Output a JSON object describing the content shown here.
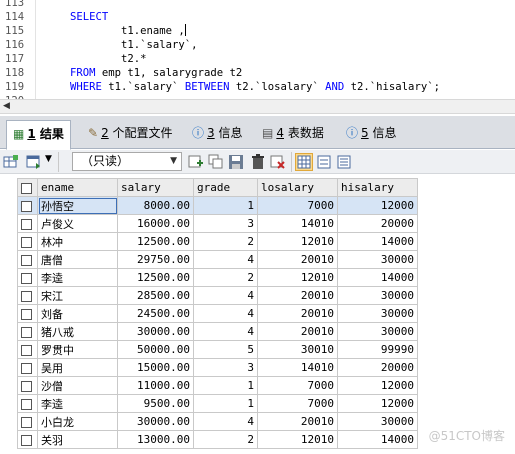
{
  "editor": {
    "lines": [
      {
        "num": "113",
        "tokens": []
      },
      {
        "num": "114",
        "tokens": [
          {
            "t": "SELECT",
            "kw": true
          }
        ]
      },
      {
        "num": "115",
        "tokens": [
          {
            "t": "        t1.ename ,",
            "kw": false
          }
        ]
      },
      {
        "num": "116",
        "tokens": [
          {
            "t": "        t1.`salary`,",
            "kw": false
          }
        ]
      },
      {
        "num": "117",
        "tokens": [
          {
            "t": "        t2.*",
            "kw": false
          }
        ]
      },
      {
        "num": "118",
        "tokens": [
          {
            "t": "FROM",
            "kw": true
          },
          {
            "t": " emp t1, salarygrade t2",
            "kw": false
          }
        ]
      },
      {
        "num": "119",
        "tokens": [
          {
            "t": "WHERE",
            "kw": true
          },
          {
            "t": " t1.`salary` ",
            "kw": false
          },
          {
            "t": "BETWEEN",
            "kw": true
          },
          {
            "t": " t2.`losalary` ",
            "kw": false
          },
          {
            "t": "AND",
            "kw": true
          },
          {
            "t": " t2.`hisalary`;",
            "kw": false
          }
        ]
      },
      {
        "num": "120",
        "tokens": []
      }
    ]
  },
  "tabs": [
    {
      "num": "1",
      "label": "结果",
      "icon": "result-grid-icon",
      "active": true
    },
    {
      "num": "2",
      "label": "个配置文件",
      "icon": "profile-icon",
      "active": false
    },
    {
      "num": "3",
      "label": "信息",
      "icon": "info-icon",
      "active": false
    },
    {
      "num": "4",
      "label": "表数据",
      "icon": "table-data-icon",
      "active": false
    },
    {
      "num": "5",
      "label": "信息",
      "icon": "info-icon",
      "active": false
    }
  ],
  "toolbar": {
    "readonly_value": "（只读）"
  },
  "grid": {
    "columns": [
      "ename",
      "salary",
      "grade",
      "losalary",
      "hisalary"
    ],
    "rows": [
      [
        "孙悟空",
        "8000.00",
        "1",
        "7000",
        "12000"
      ],
      [
        "卢俊义",
        "16000.00",
        "3",
        "14010",
        "20000"
      ],
      [
        "林冲",
        "12500.00",
        "2",
        "12010",
        "14000"
      ],
      [
        "唐僧",
        "29750.00",
        "4",
        "20010",
        "30000"
      ],
      [
        "李逵",
        "12500.00",
        "2",
        "12010",
        "14000"
      ],
      [
        "宋江",
        "28500.00",
        "4",
        "20010",
        "30000"
      ],
      [
        "刘备",
        "24500.00",
        "4",
        "20010",
        "30000"
      ],
      [
        "猪八戒",
        "30000.00",
        "4",
        "20010",
        "30000"
      ],
      [
        "罗贯中",
        "50000.00",
        "5",
        "30010",
        "99990"
      ],
      [
        "吴用",
        "15000.00",
        "3",
        "14010",
        "20000"
      ],
      [
        "沙僧",
        "11000.00",
        "1",
        "7000",
        "12000"
      ],
      [
        "李逵",
        "9500.00",
        "1",
        "7000",
        "12000"
      ],
      [
        "小白龙",
        "30000.00",
        "4",
        "20010",
        "30000"
      ],
      [
        "关羽",
        "13000.00",
        "2",
        "12010",
        "14000"
      ]
    ]
  },
  "watermark": "@51CTO博客",
  "colors": {
    "keyword": "#0000ff",
    "selection": "#d6e4f5"
  }
}
